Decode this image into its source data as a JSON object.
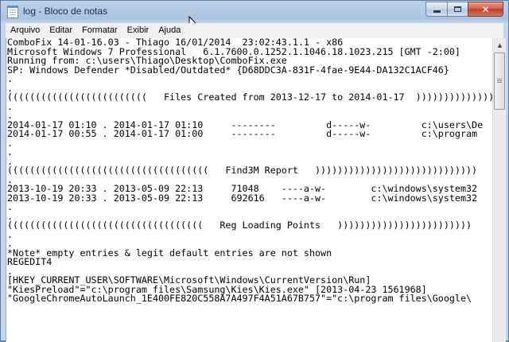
{
  "window": {
    "title": "log - Bloco de notas",
    "icon": "notepad-icon",
    "close_glyph": "✕",
    "accent": "#bcd2ea"
  },
  "menu": [
    {
      "label": "Arquivo"
    },
    {
      "label": "Editar"
    },
    {
      "label": "Formatar"
    },
    {
      "label": "Exibir"
    },
    {
      "label": "Ajuda"
    }
  ],
  "document": {
    "lines": [
      "ComboFix 14-01-16.03 - Thiago 16/01/2014  23:02:43.1.1 - x86",
      "Microsoft Windows 7 Professional   6.1.7600.0.1252.1.1046.18.1023.215 [GMT -2:00]",
      "Running from: c:\\users\\Thiago\\Desktop\\ComboFix.exe",
      "SP: Windows Defender *Disabled/Outdated* {D68DDC3A-831F-4fae-9E44-DA132C1ACF46}",
      ".",
      ".",
      "(((((((((((((((((((((((((   Files Created from 2013-12-17 to 2014-01-17  )))))))))))))))))",
      ".",
      ".",
      "2014-01-17 01:10 . 2014-01-17 01:10     --------         d-----w-         c:\\users\\De",
      "2014-01-17 00:55 . 2014-01-17 01:00     --------         d-----w-         c:\\program",
      ".",
      ".",
      ".",
      "((((((((((((((((((((((((((((((((((((   Find3M Report   )))))))))))))))))))))))))))))",
      ".",
      "2013-10-19 20:33 . 2013-05-09 22:13     71048    ----a-w-        c:\\windows\\system32",
      "2013-10-19 20:33 . 2013-05-09 22:13     692616   ----a-w-        c:\\windows\\system32",
      ".",
      ".",
      "(((((((((((((((((((((((((((((((((((   Reg Loading Points   ))))))))))))))))))))))))",
      ".",
      ".",
      "*Note* empty entries & legit default entries are not shown",
      "REGEDIT4",
      ".",
      "[HKEY_CURRENT_USER\\SOFTWARE\\Microsoft\\Windows\\CurrentVersion\\Run]",
      "\"KiesPreload\"=\"c:\\program files\\Samsung\\Kies\\Kies.exe\" [2013-04-23 1561968]",
      "\"GoogleChromeAutoLaunch_1E400FE820C558A7A497F4A51A67B757\"=\"c:\\program files\\Google\\"
    ]
  }
}
